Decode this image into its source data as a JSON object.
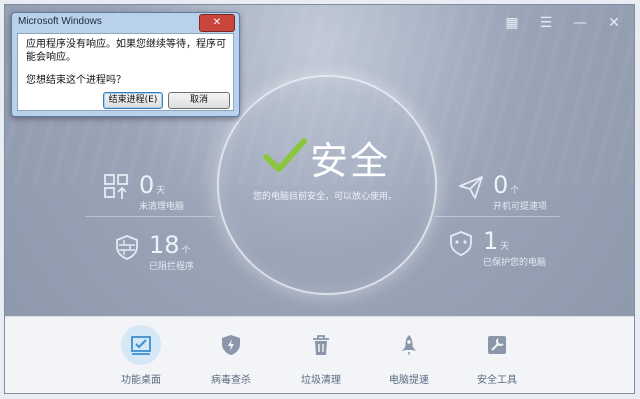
{
  "main": {
    "status_title": "安全",
    "status_desc": "您的电脑目前安全，可以放心使用。"
  },
  "stats": {
    "left": [
      {
        "value": "0",
        "unit": "天",
        "label": "未清理电脑"
      },
      {
        "value": "18",
        "unit": "个",
        "label": "已阻拦程序"
      }
    ],
    "right": [
      {
        "value": "0",
        "unit": "个",
        "label": "开机可提速项"
      },
      {
        "value": "1",
        "unit": "天",
        "label": "已保护您的电脑"
      }
    ]
  },
  "toolbar": {
    "items": [
      {
        "label": "功能桌面",
        "icon": "desktop-check-icon"
      },
      {
        "label": "病毒查杀",
        "icon": "shield-icon"
      },
      {
        "label": "垃圾清理",
        "icon": "trash-icon"
      },
      {
        "label": "电脑提速",
        "icon": "rocket-icon"
      },
      {
        "label": "安全工具",
        "icon": "tools-icon"
      }
    ]
  },
  "dialog": {
    "title": "Microsoft Windows",
    "message": "应用程序没有响应。如果您继续等待，程序可能会响应。",
    "question": "您想结束这个进程吗？",
    "end_button": "结束进程(E)",
    "cancel_button": "取消",
    "close_glyph": "✕"
  },
  "window_controls": {
    "qr": "▦",
    "menu": "☰",
    "minimize": "—",
    "close": "✕"
  },
  "colors": {
    "accent": "#8cc63f",
    "active_tool_bg": "#d6e7f5",
    "dialog_frame": "#b9d1ea"
  }
}
